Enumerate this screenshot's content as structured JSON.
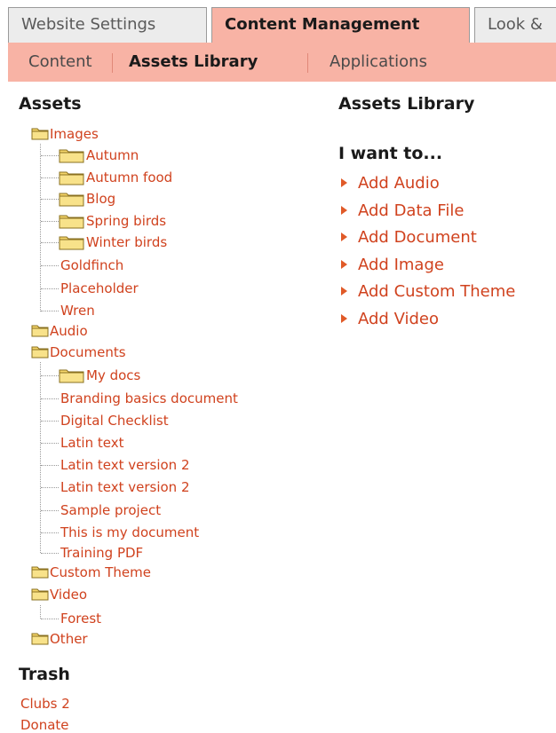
{
  "top_tabs": [
    "Website Settings",
    "Content Management",
    "Look &"
  ],
  "sub_tabs": [
    "Content",
    "Assets Library",
    "Applications"
  ],
  "assets": {
    "heading": "Assets",
    "images": "Images",
    "autumn": "Autumn",
    "autumn_food": "Autumn food",
    "blog": "Blog",
    "spring_birds": "Spring birds",
    "winter_birds": "Winter birds",
    "goldfinch": "Goldfinch",
    "placeholder": "Placeholder",
    "wren": "Wren",
    "audio": "Audio",
    "documents": "Documents",
    "my_docs": "My docs",
    "branding": "Branding basics document",
    "digital_checklist": "Digital Checklist",
    "latin_text": "Latin text",
    "latin_v2a": "Latin text version 2",
    "latin_v2b": "Latin text version 2",
    "sample_project": "Sample project",
    "my_document": "This is my document",
    "training_pdf": "Training PDF",
    "custom_theme": "Custom Theme",
    "video": "Video",
    "forest": "Forest",
    "other": "Other"
  },
  "trash": {
    "heading": "Trash",
    "items": [
      "Clubs 2",
      "Donate"
    ]
  },
  "library": {
    "heading": "Assets Library",
    "want_heading": "I want to...",
    "actions": [
      "Add Audio",
      "Add Data File",
      "Add Document",
      "Add Image",
      "Add Custom Theme",
      "Add Video"
    ]
  },
  "colors": {
    "accent": "#f8b3a5",
    "link": "#d0421e",
    "folder": "#f5d66a"
  },
  "icons": {
    "folder": "folder-icon",
    "action_arrow": "triangle-right-icon"
  }
}
